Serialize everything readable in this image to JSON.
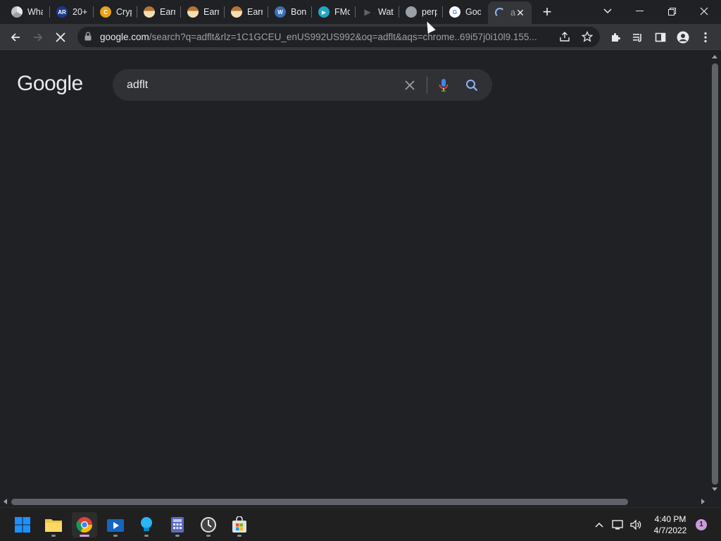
{
  "tabs": [
    {
      "title": "What",
      "favicon": "chrome-icon",
      "color": "#5f6368",
      "glyph": ""
    },
    {
      "title": "20+",
      "favicon": "ar-icon",
      "color": "#1a3a8f",
      "glyph": "AR"
    },
    {
      "title": "Cryp",
      "favicon": "coin-icon",
      "color": "#e8a317",
      "glyph": "C"
    },
    {
      "title": "Earn",
      "favicon": "earn-icon",
      "color": "#b87333",
      "glyph": ""
    },
    {
      "title": "Earn",
      "favicon": "earn-icon",
      "color": "#b87333",
      "glyph": ""
    },
    {
      "title": "Earn",
      "favicon": "earn-icon",
      "color": "#b87333",
      "glyph": ""
    },
    {
      "title": "Bon",
      "favicon": "wordpress-icon",
      "color": "#3b6fb6",
      "glyph": "W"
    },
    {
      "title": "FMo",
      "favicon": "play-icon",
      "color": "#1ea7c5",
      "glyph": "▶"
    },
    {
      "title": "Wat",
      "favicon": "play-gray-icon",
      "color": "#202124",
      "glyph": "▶"
    },
    {
      "title": "perp",
      "favicon": "globe-icon",
      "color": "#9aa0a6",
      "glyph": ""
    },
    {
      "title": "Goo",
      "favicon": "google-icon",
      "color": "#ffffff",
      "glyph": "G"
    }
  ],
  "active_tab": {
    "title": "a",
    "loading": true
  },
  "address_bar": {
    "host": "google.com",
    "path": "/search?q=adflt&rlz=1C1GCEU_enUS992US992&oq=adflt&aqs=chrome..69i57j0i10l9.155..."
  },
  "google": {
    "logo": "Google",
    "query": "adflt"
  },
  "taskbar": {
    "time": "4:40 PM",
    "date": "4/7/2022",
    "notifications": "1"
  },
  "colors": {
    "background": "#202124",
    "toolbar": "#35363a",
    "accent": "#8ab4f8"
  }
}
